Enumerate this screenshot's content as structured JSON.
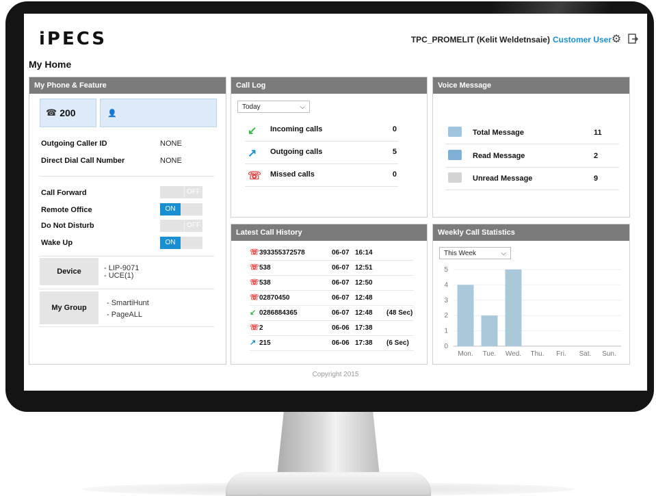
{
  "header": {
    "logo": "iPECS",
    "user_name": "TPC_PROMELIT (Kelit Weldetnsaie)",
    "user_role": "Customer User"
  },
  "page_title": "My Home",
  "my_phone": {
    "title": "My Phone & Feature",
    "extension": "200",
    "name": "",
    "outgoing_caller_id_label": "Outgoing Caller ID",
    "outgoing_caller_id_value": "NONE",
    "direct_dial_label": "Direct Dial Call Number",
    "direct_dial_value": "NONE",
    "features": [
      {
        "label": "Call Forward",
        "state": "OFF"
      },
      {
        "label": "Remote Office",
        "state": "ON"
      },
      {
        "label": "Do Not Disturb",
        "state": "OFF"
      },
      {
        "label": "Wake Up",
        "state": "ON"
      }
    ],
    "device_label": "Device",
    "device_values": [
      "- LIP-9071",
      "- UCE(1)"
    ],
    "group_label": "My Group",
    "group_values": [
      "- SmartiHunt",
      "- PageALL"
    ]
  },
  "call_log": {
    "title": "Call Log",
    "filter": "Today",
    "rows": [
      {
        "label": "Incoming calls",
        "count": "0"
      },
      {
        "label": "Outgoing calls",
        "count": "5"
      },
      {
        "label": "Missed calls",
        "count": "0"
      }
    ]
  },
  "voice_message": {
    "title": "Voice Message",
    "rows": [
      {
        "label": "Total Message",
        "count": "11"
      },
      {
        "label": "Read Message",
        "count": "2"
      },
      {
        "label": "Unread Message",
        "count": "9"
      }
    ]
  },
  "latest_history": {
    "title": "Latest Call History",
    "rows": [
      {
        "type": "missed",
        "number": "393355372578",
        "date": "06-07",
        "time": "16:14",
        "duration": ""
      },
      {
        "type": "missed",
        "number": "538",
        "date": "06-07",
        "time": "12:51",
        "duration": ""
      },
      {
        "type": "missed",
        "number": "538",
        "date": "06-07",
        "time": "12:50",
        "duration": ""
      },
      {
        "type": "missed",
        "number": "02870450",
        "date": "06-07",
        "time": "12:48",
        "duration": ""
      },
      {
        "type": "incoming",
        "number": "0286884365",
        "date": "06-07",
        "time": "12:48",
        "duration": "(48 Sec)"
      },
      {
        "type": "missed",
        "number": "2",
        "date": "06-06",
        "time": "17:38",
        "duration": ""
      },
      {
        "type": "outgoing",
        "number": "215",
        "date": "06-06",
        "time": "17:38",
        "duration": "(6 Sec)"
      }
    ]
  },
  "weekly_stats": {
    "title": "Weekly Call Statistics",
    "filter": "This Week"
  },
  "chart_data": {
    "type": "bar",
    "categories": [
      "Mon.",
      "Tue.",
      "Wed.",
      "Thu.",
      "Fri.",
      "Sat.",
      "Sun."
    ],
    "values": [
      4,
      2,
      5,
      0,
      0,
      0,
      0
    ],
    "yticks": [
      "0",
      "1",
      "2",
      "3",
      "4",
      "5"
    ],
    "ylim": [
      0,
      5
    ],
    "bar_color": "#a9c9da",
    "grid": true
  },
  "colors": {
    "accent": "#1a8fd1",
    "missed": "#e23a3a",
    "incoming": "#3cb84a",
    "outgoing": "#1a8fd1",
    "panel_header": "#7b7b7b"
  },
  "footer": {
    "copyright": "Copyright 2015"
  }
}
